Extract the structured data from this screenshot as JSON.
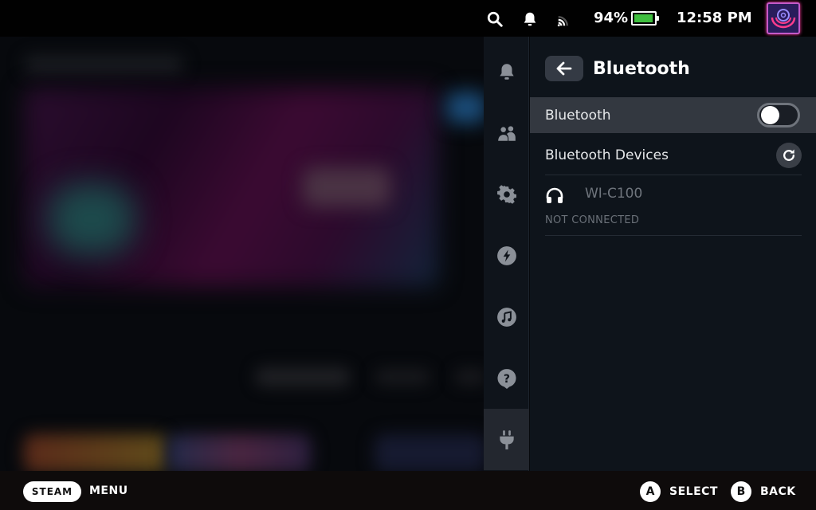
{
  "status_bar": {
    "battery_percent_label": "94%",
    "battery_level": 0.94,
    "battery_color": "#3fbf3f",
    "clock": "12:58 PM",
    "icons": [
      "search-icon",
      "notification-bell-icon",
      "cast-signal-icon",
      "battery-icon",
      "user-avatar"
    ]
  },
  "side_rail": {
    "items": [
      {
        "name": "notifications",
        "icon": "bell-icon",
        "active": false
      },
      {
        "name": "friends",
        "icon": "friends-icon",
        "active": false
      },
      {
        "name": "settings",
        "icon": "gear-icon",
        "active": false
      },
      {
        "name": "performance",
        "icon": "lightning-bolt-icon",
        "active": false
      },
      {
        "name": "music",
        "icon": "music-note-icon",
        "active": false
      },
      {
        "name": "help",
        "icon": "question-mark-icon",
        "active": false
      },
      {
        "name": "power",
        "icon": "plug-icon",
        "active": true
      }
    ]
  },
  "panel": {
    "title": "Bluetooth",
    "bluetooth_toggle": {
      "label": "Bluetooth",
      "enabled": false
    },
    "devices_header": "Bluetooth Devices",
    "devices": [
      {
        "name": "WI-C100",
        "icon": "headphones-icon",
        "status": "NOT CONNECTED"
      }
    ]
  },
  "bottom_bar": {
    "steam_button": "STEAM",
    "menu_label": "MENU",
    "hints": [
      {
        "button": "A",
        "label": "SELECT"
      },
      {
        "button": "B",
        "label": "BACK"
      }
    ]
  }
}
